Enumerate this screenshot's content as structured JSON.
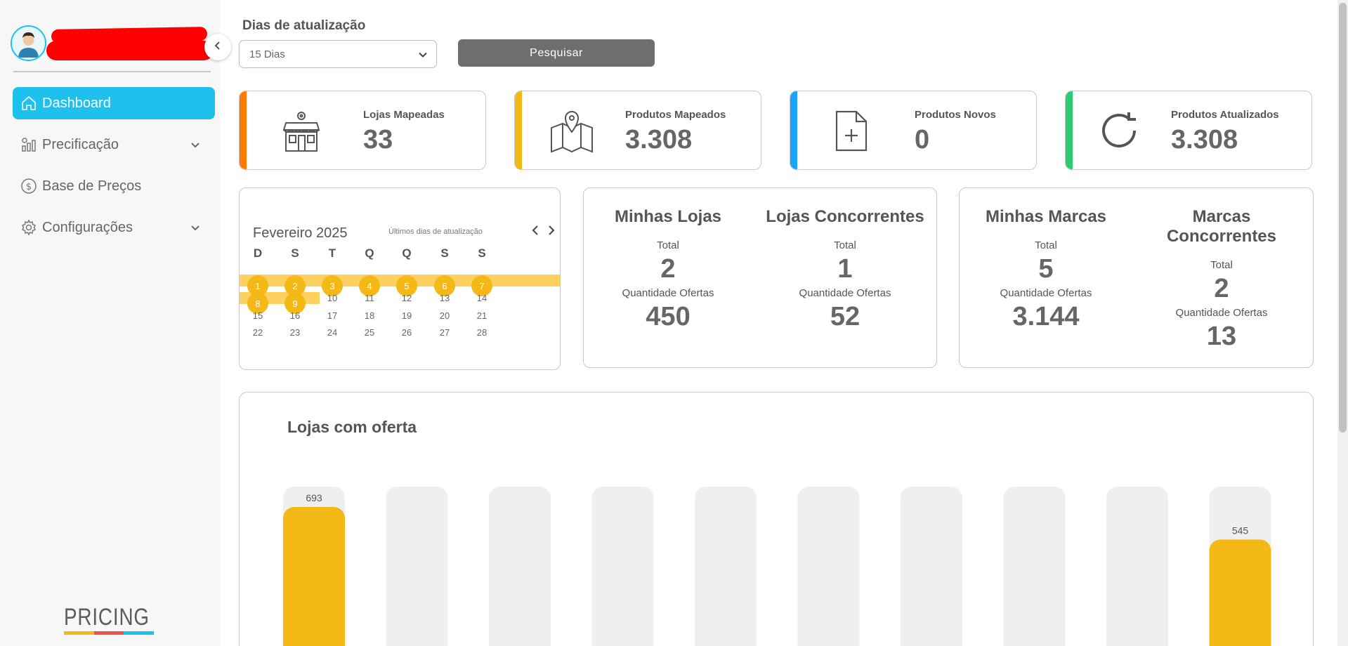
{
  "sidebar": {
    "items": [
      {
        "label": "Dashboard",
        "icon": "home-icon",
        "active": true
      },
      {
        "label": "Precificação",
        "icon": "pricing-chart-icon",
        "has_submenu": true
      },
      {
        "label": "Base de Preços",
        "icon": "dollar-circle-icon"
      },
      {
        "label": "Configurações",
        "icon": "gear-icon",
        "has_submenu": true
      }
    ],
    "logo": "PRICING"
  },
  "filters": {
    "label": "Dias de atualização",
    "selected": "15 Dias",
    "button": "Pesquisar"
  },
  "kpis": [
    {
      "label": "Lojas Mapeadas",
      "value": "33",
      "color": "#ff7a00",
      "icon": "storefront-icon"
    },
    {
      "label": "Produtos Mapeados",
      "value": "3.308",
      "color": "#f5b917",
      "icon": "map-pin-icon"
    },
    {
      "label": "Produtos Novos",
      "value": "0",
      "color": "#1aa3ff",
      "icon": "file-plus-icon"
    },
    {
      "label": "Produtos Atualizados",
      "value": "3.308",
      "color": "#2ecc71",
      "icon": "refresh-icon"
    }
  ],
  "calendar": {
    "title": "Fevereiro 2025",
    "subtitle": "Últimos dias de atualização",
    "weekdays": [
      "D",
      "S",
      "T",
      "Q",
      "Q",
      "S",
      "S"
    ],
    "weeks": [
      [
        "1",
        "2",
        "3",
        "4",
        "5",
        "6",
        "7"
      ],
      [
        "8",
        "9",
        "10",
        "11",
        "12",
        "13",
        "14"
      ],
      [
        "15",
        "16",
        "17",
        "18",
        "19",
        "20",
        "21"
      ],
      [
        "22",
        "23",
        "24",
        "25",
        "26",
        "27",
        "28"
      ]
    ],
    "highlighted": [
      "1",
      "2",
      "3",
      "4",
      "5",
      "6",
      "7",
      "8",
      "9"
    ]
  },
  "stores": {
    "mine": {
      "title": "Minhas Lojas",
      "total_label": "Total",
      "total": "2",
      "offers_label": "Quantidade Ofertas",
      "offers": "450"
    },
    "competitors": {
      "title": "Lojas Concorrentes",
      "total_label": "Total",
      "total": "1",
      "offers_label": "Quantidade Ofertas",
      "offers": "52"
    }
  },
  "brands": {
    "mine": {
      "title": "Minhas Marcas",
      "total_label": "Total",
      "total": "5",
      "offers_label": "Quantidade Ofertas",
      "offers": "3.144"
    },
    "competitors": {
      "title": "Marcas Concorrentes",
      "total_label": "Total",
      "total": "2",
      "offers_label": "Quantidade Ofertas",
      "offers": "13"
    }
  },
  "chart_data": {
    "type": "bar",
    "title": "Lojas com oferta",
    "values": [
      693,
      null,
      null,
      null,
      null,
      null,
      null,
      null,
      null,
      545
    ],
    "value_labels": [
      "693",
      "",
      "",
      "",
      "",
      "",
      "",
      "",
      "",
      "545"
    ],
    "bar_color": "#f5b917",
    "track_color": "#efefef"
  }
}
